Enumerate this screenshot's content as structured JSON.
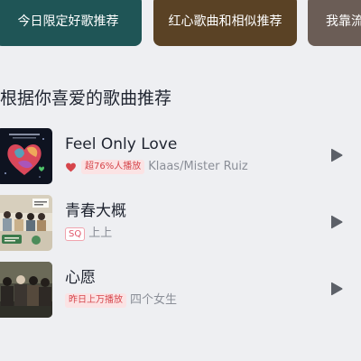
{
  "top_cards": [
    {
      "label": "今日限定好歌推荐",
      "color": "#1f5556"
    },
    {
      "label": "红心歌曲和相似推荐",
      "color": "#5a4225"
    },
    {
      "label": "我靠流",
      "color": "#6b5d56"
    }
  ],
  "section_title": "根据你喜爱的歌曲推荐",
  "songs": [
    {
      "title": "Feel Only Love",
      "tag": "超76%人播放",
      "artist": "Klaas/Mister Ruiz",
      "icon": "heart-icon"
    },
    {
      "title": "青春大概",
      "tag": "SQ",
      "artist": "上上"
    },
    {
      "title": "心愿",
      "tag": "昨日上万播放",
      "artist": "四个女生"
    }
  ],
  "colors": {
    "background": "#eeeff2",
    "tag_red": "#d6454b",
    "tag_bg": "#fbe3e4",
    "play_icon": "#5c6068",
    "artist_gray": "#8b8f98"
  }
}
